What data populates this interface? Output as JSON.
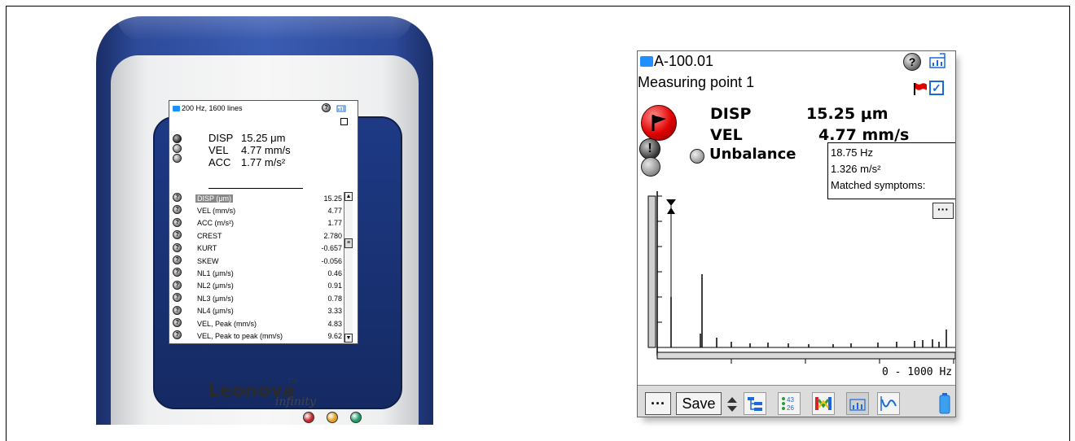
{
  "device": {
    "brand": "Leonova",
    "brand_tm": "TM",
    "brand_sub": "infinity",
    "screen": {
      "header": "200 Hz, 1600 lines",
      "readings": [
        {
          "label": "DISP",
          "value": "15.25 μm"
        },
        {
          "label": "VEL",
          "value": "4.77 mm/s"
        },
        {
          "label": "ACC",
          "value": "1.77 m/s²"
        }
      ],
      "list": [
        {
          "name": "DISP (μm)",
          "value": "15.25",
          "selected": true
        },
        {
          "name": "VEL (mm/s)",
          "value": "4.77"
        },
        {
          "name": "ACC (m/s²)",
          "value": "1.77"
        },
        {
          "name": "CREST",
          "value": "2.780"
        },
        {
          "name": "KURT",
          "value": "-0.657"
        },
        {
          "name": "SKEW",
          "value": "-0.056"
        },
        {
          "name": "NL1 (μm/s)",
          "value": "0.46"
        },
        {
          "name": "NL2 (μm/s)",
          "value": "0.91"
        },
        {
          "name": "NL3 (μm/s)",
          "value": "0.78"
        },
        {
          "name": "NL4 (μm/s)",
          "value": "3.33"
        },
        {
          "name": "VEL, Peak (mm/s)",
          "value": "4.83"
        },
        {
          "name": "VEL, Peak to peak (mm/s)",
          "value": "9.62"
        }
      ]
    },
    "leds": [
      "#c0282d",
      "#e0a020",
      "#1f9a6a"
    ]
  },
  "app": {
    "title": "A-100.01",
    "subtitle": "Measuring point 1",
    "help_glyph": "?",
    "readings": [
      {
        "label": "DISP",
        "value": "15.25 μm"
      },
      {
        "label": "VEL",
        "value": "4.77 mm/s"
      }
    ],
    "symptom": "Unbalance",
    "tooltip": {
      "freq": "18.75 Hz",
      "amp": "1.326 m/s²",
      "matched": "Matched symptoms:"
    },
    "more_label": "···",
    "range": "0 - 1000 Hz",
    "toolbar": {
      "more": "···",
      "save": "Save"
    },
    "icons": [
      "help-icon",
      "export-icon",
      "red-flag-icon",
      "checkbox-icon",
      "tree-view-icon",
      "numeric-view-icon",
      "color-map-icon",
      "spectrum-icon",
      "waveform-icon",
      "battery-icon"
    ]
  }
}
